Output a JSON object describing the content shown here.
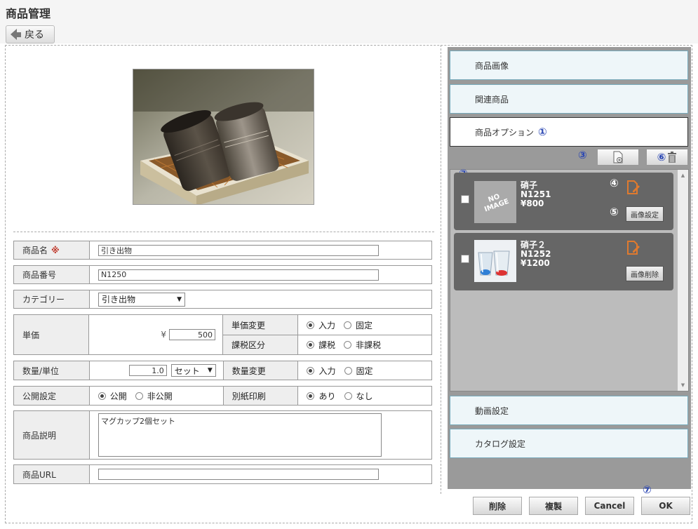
{
  "header": {
    "title": "商品管理",
    "back_label": "戻る"
  },
  "form": {
    "name": {
      "label": "商品名",
      "required": "※",
      "value": "引き出物"
    },
    "number": {
      "label": "商品番号",
      "value": "N1250"
    },
    "category": {
      "label": "カテゴリー",
      "value": "引き出物"
    },
    "price": {
      "label": "単価",
      "currency": "¥",
      "value": "500"
    },
    "price_change": {
      "label": "単価変更",
      "options": [
        "入力",
        "固定"
      ],
      "selected": "入力"
    },
    "tax": {
      "label": "課税区分",
      "options": [
        "課税",
        "非課税"
      ],
      "selected": "課税"
    },
    "qty": {
      "label": "数量/単位",
      "value": "1.0",
      "unit": "セット"
    },
    "qty_change": {
      "label": "数量変更",
      "options": [
        "入力",
        "固定"
      ],
      "selected": "入力"
    },
    "publish": {
      "label": "公開設定",
      "options": [
        "公開",
        "非公開"
      ],
      "selected": "公開"
    },
    "print": {
      "label": "別紙印刷",
      "options": [
        "あり",
        "なし"
      ],
      "selected": "あり"
    },
    "desc": {
      "label": "商品説明",
      "value": "マグカップ2個セット"
    },
    "url": {
      "label": "商品URL",
      "value": ""
    }
  },
  "panel": {
    "sections": {
      "images": "商品画像",
      "related": "関連商品",
      "options": "商品オプション",
      "video": "動画設定",
      "catalog": "カタログ設定"
    },
    "markers": {
      "m1": "①",
      "m2": "②",
      "m3": "③",
      "m4": "④",
      "m5": "⑤",
      "m6": "⑥",
      "m7": "⑦"
    },
    "options": [
      {
        "name": "硝子",
        "code": "N1251",
        "price": "¥800",
        "button": "画像設定",
        "noimage_line1": "NO",
        "noimage_line2": "IMAGE"
      },
      {
        "name": "硝子２",
        "code": "N1252",
        "price": "¥1200",
        "button": "画像削除"
      }
    ]
  },
  "footer": {
    "delete": "削除",
    "copy": "複製",
    "cancel": "Cancel",
    "ok": "OK"
  },
  "colors": {
    "accent_marker": "#2b47b3",
    "required": "#c0392b",
    "panel_bg": "#9a9a9a",
    "card_bg": "#666666"
  }
}
